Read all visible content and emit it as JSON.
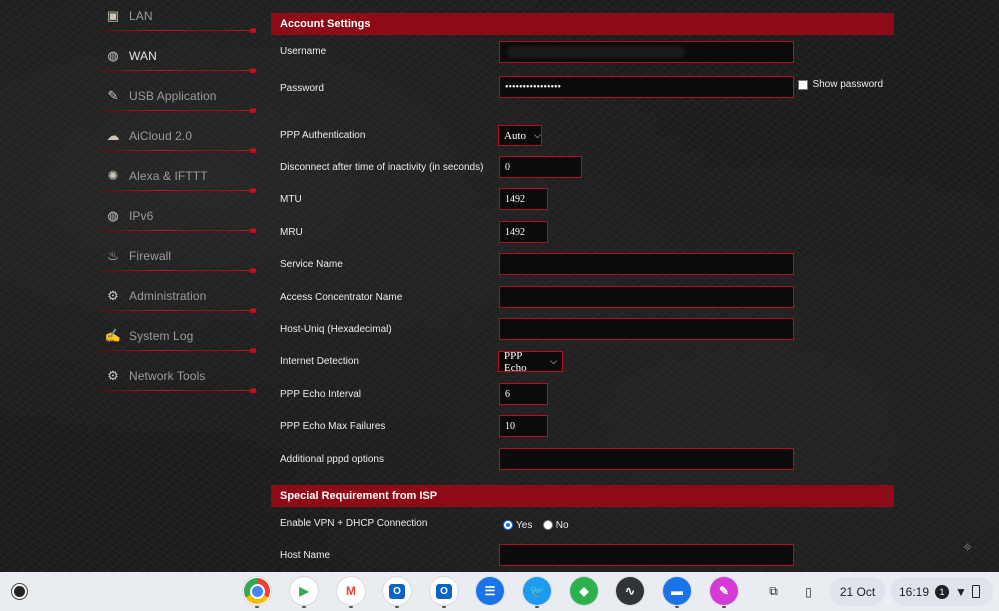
{
  "sidebar": {
    "items": [
      {
        "label": "LAN",
        "icon": "lan-icon",
        "glyph": "▣"
      },
      {
        "label": "WAN",
        "icon": "globe-icon",
        "glyph": "◍"
      },
      {
        "label": "USB Application",
        "icon": "usb-icon",
        "glyph": "✎"
      },
      {
        "label": "AiCloud 2.0",
        "icon": "cloud-icon",
        "glyph": "☁"
      },
      {
        "label": "Alexa & IFTTT",
        "icon": "alexa-icon",
        "glyph": "✺"
      },
      {
        "label": "IPv6",
        "icon": "ipv6-globe-icon",
        "glyph": "◍"
      },
      {
        "label": "Firewall",
        "icon": "firewall-icon",
        "glyph": "♨"
      },
      {
        "label": "Administration",
        "icon": "gear-icon",
        "glyph": "⚙"
      },
      {
        "label": "System Log",
        "icon": "log-icon",
        "glyph": "✍"
      },
      {
        "label": "Network Tools",
        "icon": "tools-icon",
        "glyph": "⚙"
      }
    ],
    "active": "WAN"
  },
  "account": {
    "title": "Account Settings",
    "username_label": "Username",
    "password_label": "Password",
    "password_value": "••••••••••••••••",
    "show_password_label": "Show password",
    "ppp_auth_label": "PPP Authentication",
    "ppp_auth_value": "Auto",
    "disconnect_label": "Disconnect after time of inactivity (in seconds)",
    "disconnect_value": "0",
    "mtu_label": "MTU",
    "mtu_value": "1492",
    "mru_label": "MRU",
    "mru_value": "1492",
    "service_name_label": "Service Name",
    "service_name_value": "",
    "ac_name_label": "Access Concentrator Name",
    "ac_name_value": "",
    "host_uniq_label": "Host-Uniq (Hexadecimal)",
    "host_uniq_value": "",
    "internet_detection_label": "Internet Detection",
    "internet_detection_value": "PPP Echo",
    "echo_interval_label": "PPP Echo Interval",
    "echo_interval_value": "6",
    "echo_failures_label": "PPP Echo Max Failures",
    "echo_failures_value": "10",
    "pppd_options_label": "Additional pppd options",
    "pppd_options_value": ""
  },
  "isp": {
    "title": "Special Requirement from ISP",
    "vpn_dhcp_label": "Enable VPN + DHCP Connection",
    "yes_label": "Yes",
    "no_label": "No",
    "vpn_dhcp_value": "Yes",
    "host_name_label": "Host Name",
    "host_name_value": ""
  },
  "shelf": {
    "apps": [
      {
        "name": "chrome-icon",
        "bg": "#ffffff",
        "glyph": ""
      },
      {
        "name": "play-store-icon",
        "bg": "#ffffff",
        "glyph": "▶"
      },
      {
        "name": "gmail-icon",
        "bg": "#ffffff",
        "glyph": "M"
      },
      {
        "name": "outlook-icon",
        "bg": "#ffffff",
        "glyph": "O"
      },
      {
        "name": "outlook-alt-icon",
        "bg": "#ffffff",
        "glyph": "O"
      },
      {
        "name": "messages-icon",
        "bg": "#1a73e8",
        "glyph": "☰"
      },
      {
        "name": "twitter-icon",
        "bg": "#1d9bf0",
        "glyph": "🐦"
      },
      {
        "name": "feedly-icon",
        "bg": "#2bb24c",
        "glyph": "◆"
      },
      {
        "name": "activity-icon",
        "bg": "#2f3437",
        "glyph": "∿"
      },
      {
        "name": "files-icon",
        "bg": "#1a73e8",
        "glyph": "▬"
      },
      {
        "name": "photos-editor-icon",
        "bg": "#d63ad6",
        "glyph": "✎"
      }
    ],
    "date": "21 Oct",
    "time": "16:19",
    "notification_count": "1"
  }
}
